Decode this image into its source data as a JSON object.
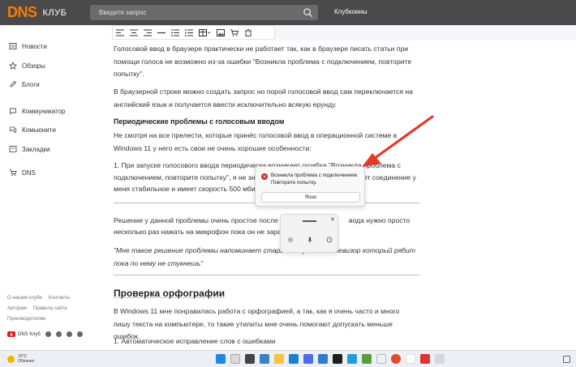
{
  "header": {
    "logo_main": "DNS",
    "logo_sub": "КЛУБ",
    "search_placeholder": "Введите запрос",
    "link": "Клубкоины"
  },
  "sidebar": {
    "items": [
      {
        "label": "Новости",
        "icon": "news-icon"
      },
      {
        "label": "Обзоры",
        "icon": "star-icon"
      },
      {
        "label": "Блоги",
        "icon": "pencil-icon"
      },
      {
        "label": "Коммуникатор",
        "icon": "chat-icon"
      },
      {
        "label": "Комьюнити",
        "icon": "community-icon"
      },
      {
        "label": "Закладки",
        "icon": "bookmark-icon"
      },
      {
        "label": "DNS",
        "icon": "cart-icon"
      }
    ],
    "footer_links": [
      {
        "label": "О нашем клубе"
      },
      {
        "label": "Контакты"
      },
      {
        "label": "Авторам"
      },
      {
        "label": "Правила сайта"
      },
      {
        "label": "Производителям"
      }
    ],
    "brand": "DNS Клуб"
  },
  "article": {
    "p1": "Голосовой ввод в браузере практически не работает так, как в браузере писать статьи при помощи голоса не возможно из-за ошибки \"Возникла проблема с подключением, повторите попытку\".",
    "p2": "В браузерной строке можно создать запрос но порой голосовой ввод сам переключается на английский язык и получается ввести исключительно всякую ерунду.",
    "h3": "Периодические проблемы с голосовым вводом",
    "p3": "Не смотря на все прелести, которые принёс голосовой ввод в операционной системе в Windows 11 у него есть свои не очень хорошие особенности:",
    "p4a": "1. При запуске голосового ввода периодически возникает ошибка \"Возникла проблема с",
    "p4b": "подключением, повторите попытку\", я не зна",
    "p4b_tail": "ет соединение у",
    "p4c": "меня стабильное и имеет скорость 500 мбит",
    "p5a": "Решение у данной проблемы очень простое после за",
    "p5a_tail": "вода нужно просто",
    "p5b": "несколько раз нажать на микрофон пока он не зараб",
    "quote": "\"Мне такое решение проблемы напоминает старый бабушкин телевизор который рябит пока по нему не стукнешь\"",
    "h2": "Проверка орфографии",
    "p6": "В Windows 11 мне понравилась работа с орфографией, а так, как я очень часто и много пишу текста на компьютере, то такие утилиты мне очень помогают допускать меньше ошибок.",
    "p7": "1. Автоматическое исправление слов с ошибками"
  },
  "popup": {
    "message": "Возникла проблема с подключением. Повторите попытку.",
    "button": "Ясно"
  },
  "taskbar": {
    "temperature": "15°C",
    "weather": "Облачно"
  },
  "colors": {
    "header_bg": "#4a4a4a",
    "brand_orange": "#ff7a00",
    "arrow": "#e03a2e",
    "error_red": "#c42b1c"
  }
}
